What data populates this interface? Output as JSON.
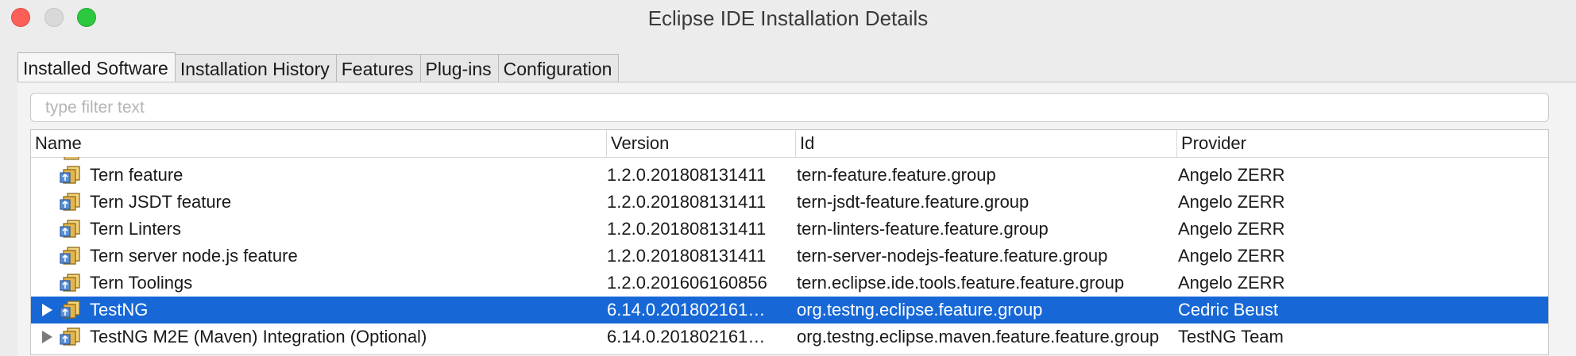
{
  "window": {
    "title": "Eclipse IDE Installation Details"
  },
  "tabs": [
    {
      "label": "Installed Software",
      "active": true
    },
    {
      "label": "Installation History",
      "active": false
    },
    {
      "label": "Features",
      "active": false
    },
    {
      "label": "Plug-ins",
      "active": false
    },
    {
      "label": "Configuration",
      "active": false
    }
  ],
  "filter": {
    "placeholder": "type filter text",
    "value": ""
  },
  "table": {
    "columns": [
      "Name",
      "Version",
      "Id",
      "Provider"
    ],
    "rows": [
      {
        "name": "Tern feature",
        "version": "1.2.0.201808131411",
        "id": "tern-feature.feature.group",
        "provider": "Angelo ZERR",
        "expandable": false,
        "selected": false
      },
      {
        "name": "Tern JSDT feature",
        "version": "1.2.0.201808131411",
        "id": "tern-jsdt-feature.feature.group",
        "provider": "Angelo ZERR",
        "expandable": false,
        "selected": false
      },
      {
        "name": "Tern Linters",
        "version": "1.2.0.201808131411",
        "id": "tern-linters-feature.feature.group",
        "provider": "Angelo ZERR",
        "expandable": false,
        "selected": false
      },
      {
        "name": "Tern server node.js feature",
        "version": "1.2.0.201808131411",
        "id": "tern-server-nodejs-feature.feature.group",
        "provider": "Angelo ZERR",
        "expandable": false,
        "selected": false
      },
      {
        "name": "Tern Toolings",
        "version": "1.2.0.201606160856",
        "id": "tern.eclipse.ide.tools.feature.feature.group",
        "provider": "Angelo ZERR",
        "expandable": false,
        "selected": false
      },
      {
        "name": "TestNG",
        "version": "6.14.0.201802161…",
        "id": "org.testng.eclipse.feature.group",
        "provider": "Cedric Beust",
        "expandable": true,
        "selected": true
      },
      {
        "name": "TestNG M2E (Maven) Integration (Optional)",
        "version": "6.14.0.201802161…",
        "id": "org.testng.eclipse.maven.feature.feature.group",
        "provider": "TestNG Team",
        "expandable": true,
        "selected": false
      }
    ]
  },
  "colors": {
    "selection": "#1768d6",
    "close": "#fc5f57",
    "maximize": "#2bc840"
  },
  "icons": {
    "feature": "feature-group-icon"
  }
}
